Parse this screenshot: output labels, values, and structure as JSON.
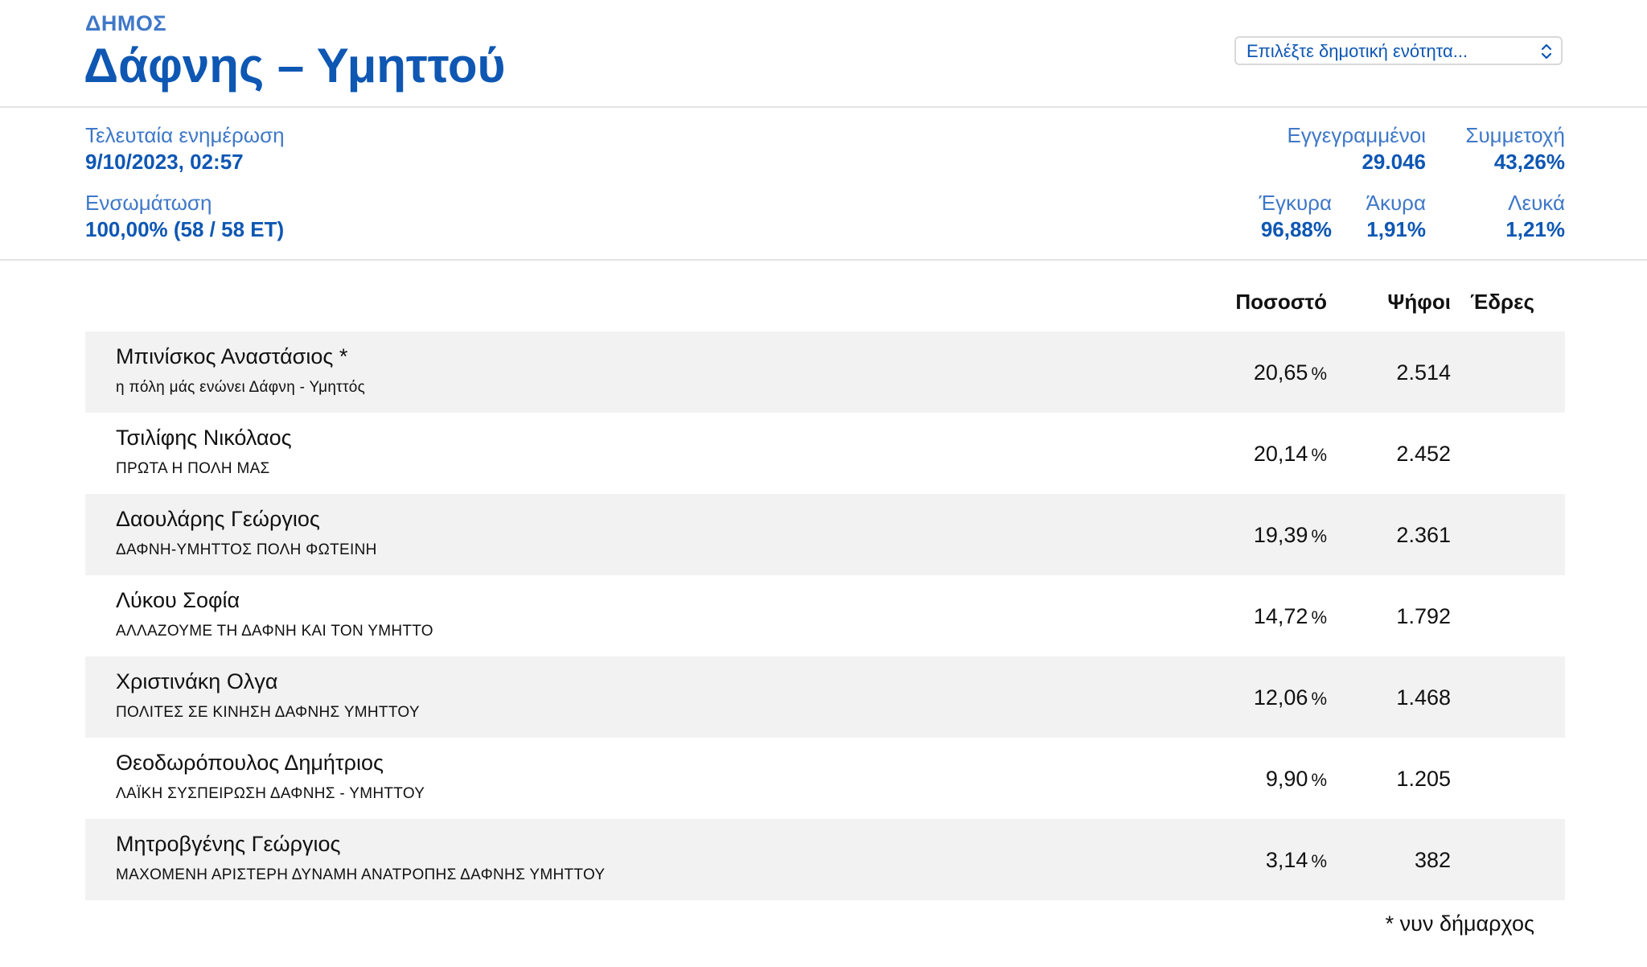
{
  "header": {
    "municipality_label": "ΔΗΜΟΣ",
    "municipality_title": "Δάφνης – Υμηττού",
    "unit_select": {
      "placeholder": "Επιλέξτε δημοτική ενότητα...",
      "icon": "up-down-chevron-icon"
    }
  },
  "stats": {
    "last_update": {
      "label": "Τελευταία ενημέρωση",
      "value": "9/10/2023, 02:57"
    },
    "integration": {
      "label": "Ενσωμάτωση",
      "value": "100,00% (58 / 58 ΕΤ)"
    },
    "registered": {
      "label": "Εγγεγραμμένοι",
      "value": "29.046"
    },
    "turnout": {
      "label": "Συμμετοχή",
      "value": "43,26%"
    },
    "valid": {
      "label": "Έγκυρα",
      "value": "96,88%"
    },
    "invalid": {
      "label": "Άκυρα",
      "value": "1,91%"
    },
    "blank": {
      "label": "Λευκά",
      "value": "1,21%"
    }
  },
  "table": {
    "columns": {
      "percent": "Ποσοστό",
      "votes": "Ψήφοι",
      "seats": "Έδρες"
    },
    "percent_unit": "%",
    "rows": [
      {
        "name": "Μπινίσκος Αναστάσιος *",
        "list": "η πόλη μάς ενώνει Δάφνη - Υμηττός",
        "percent": "20,65",
        "votes": "2.514"
      },
      {
        "name": "Τσιλίφης Νικόλαος",
        "list": "ΠΡΩΤΑ Η ΠΟΛΗ ΜΑΣ",
        "percent": "20,14",
        "votes": "2.452"
      },
      {
        "name": "Δαουλάρης Γεώργιος",
        "list": "ΔΑΦΝΗ-ΥΜΗΤΤΟΣ ΠΟΛΗ ΦΩΤΕΙΝΗ",
        "percent": "19,39",
        "votes": "2.361"
      },
      {
        "name": "Λύκου Σοφία",
        "list": "ΑΛΛΑΖΟΥΜΕ ΤΗ ΔΑΦΝΗ ΚΑΙ ΤΟΝ ΥΜΗΤΤΟ",
        "percent": "14,72",
        "votes": "1.792"
      },
      {
        "name": "Χριστινάκη Ολγα",
        "list": "ΠΟΛΙΤΕΣ ΣΕ ΚΙΝΗΣΗ ΔΑΦΝΗΣ ΥΜΗΤΤΟΥ",
        "percent": "12,06",
        "votes": "1.468"
      },
      {
        "name": "Θεοδωρόπουλος Δημήτριος",
        "list": "ΛΑΪΚΗ ΣΥΣΠΕΙΡΩΣΗ ΔΑΦΝΗΣ - ΥΜΗΤΤΟΥ",
        "percent": "9,90",
        "votes": "1.205"
      },
      {
        "name": "Μητροβγένης Γεώργιος",
        "list": "ΜΑΧΟΜΕΝΗ ΑΡΙΣΤΕΡΗ ΔΥΝΑΜΗ ΑΝΑΤΡΟΠΗΣ ΔΑΦΝΗΣ ΥΜΗΤΤΟΥ",
        "percent": "3,14",
        "votes": "382"
      }
    ]
  },
  "footnote": "* νυν δήμαρχος",
  "colors": {
    "accent": "#0e57b3",
    "accent_light": "#3f78c8",
    "row_shade": "#f2f2f2",
    "divider": "#e3e3e3"
  }
}
